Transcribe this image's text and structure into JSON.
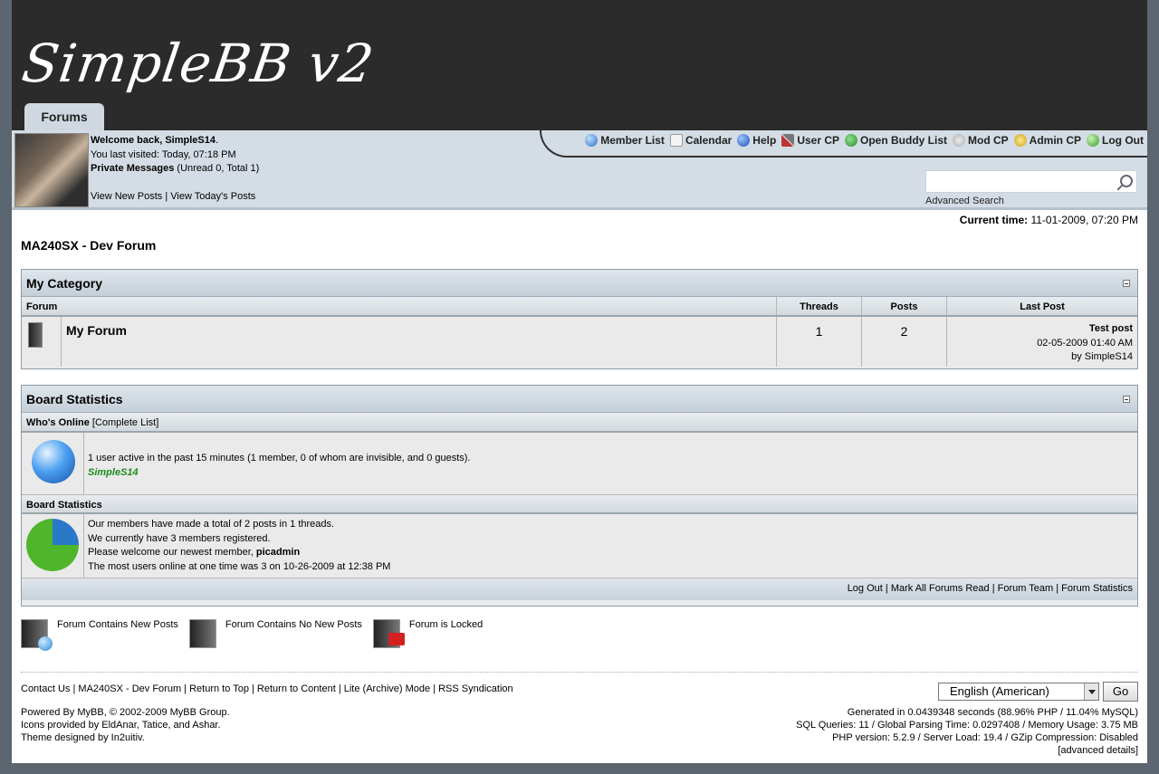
{
  "header": {
    "logo": "SimpleBB v2",
    "tab": "Forums"
  },
  "welcome": {
    "greeting_prefix": "Welcome back,",
    "username": "SimpleS14",
    "greeting_suffix": ".",
    "last_visited": "You last visited: Today, 07:18 PM",
    "pm_label": "Private Messages",
    "pm_counts": "(Unread 0, Total 1)",
    "view_new": "View New Posts",
    "sep": "|",
    "view_today": "View Today's Posts"
  },
  "nav": {
    "items": [
      {
        "label": "Member List",
        "icon": "globe-icon"
      },
      {
        "label": "Calendar",
        "icon": "calendar-icon"
      },
      {
        "label": "Help",
        "icon": "help-icon"
      },
      {
        "label": "User CP",
        "icon": "tools-icon"
      },
      {
        "label": "Open Buddy List",
        "icon": "buddies-icon"
      },
      {
        "label": "Mod CP",
        "icon": "mod-icon"
      },
      {
        "label": "Admin CP",
        "icon": "admin-icon"
      },
      {
        "label": "Log Out",
        "icon": "logout-icon"
      }
    ]
  },
  "search": {
    "placeholder": "",
    "advanced": "Advanced Search"
  },
  "time": {
    "label": "Current time:",
    "value": "11-01-2009, 07:20 PM"
  },
  "board_title": "MA240SX - Dev Forum",
  "category": {
    "title": "My Category",
    "columns": {
      "forum": "Forum",
      "threads": "Threads",
      "posts": "Posts",
      "lastpost": "Last Post"
    },
    "forums": [
      {
        "name": "My Forum",
        "threads": "1",
        "posts": "2",
        "last_title": "Test post",
        "last_date": "02-05-2009 01:40 AM",
        "last_by": "by SimpleS14"
      }
    ]
  },
  "stats": {
    "title": "Board Statistics",
    "online_header": "Who's Online",
    "online_link": "[Complete List]",
    "online_text": "1 user active in the past 15 minutes (1 member, 0 of whom are invisible, and 0 guests).",
    "online_user": "SimpleS14",
    "board_header": "Board Statistics",
    "line1": "Our members have made a total of 2 posts in 1 threads.",
    "line2": "We currently have 3 members registered.",
    "line3_prefix": "Please welcome our newest member,",
    "line3_member": "picadmin",
    "line4": "The most users online at one time was 3 on 10-26-2009 at 12:38 PM",
    "footer_links": [
      "Log Out",
      "Mark All Forums Read",
      "Forum Team",
      "Forum Statistics"
    ],
    "footer_sep": "|"
  },
  "legend": {
    "new": "Forum Contains New Posts",
    "nonew": "Forum Contains No New Posts",
    "locked": "Forum is Locked"
  },
  "footer": {
    "links": [
      "Contact Us",
      "MA240SX - Dev Forum",
      "Return to Top",
      "Return to Content",
      "Lite (Archive) Mode",
      "RSS Syndication"
    ],
    "sep": "|",
    "powered1": "Powered By MyBB, © 2002-2009 MyBB Group.",
    "powered2": "Icons provided by EldAnar, Tatice, and Ashar.",
    "powered3": "Theme designed by In2uitiv.",
    "language": "English (American)",
    "go": "Go",
    "debug1": "Generated in 0.0439348 seconds (88.96% PHP / 11.04% MySQL)",
    "debug2": "SQL Queries: 11 / Global Parsing Time: 0.0297408 / Memory Usage: 3.75 MB",
    "debug3": "PHP version: 5.2.9 / Server Load: 19.4 / GZip Compression: Disabled",
    "debug4": "[advanced details]"
  },
  "colors": {
    "header_bg": "#2b2b2b",
    "bar_bg": "#d4dde5",
    "online_user": "#1c8c1c"
  }
}
